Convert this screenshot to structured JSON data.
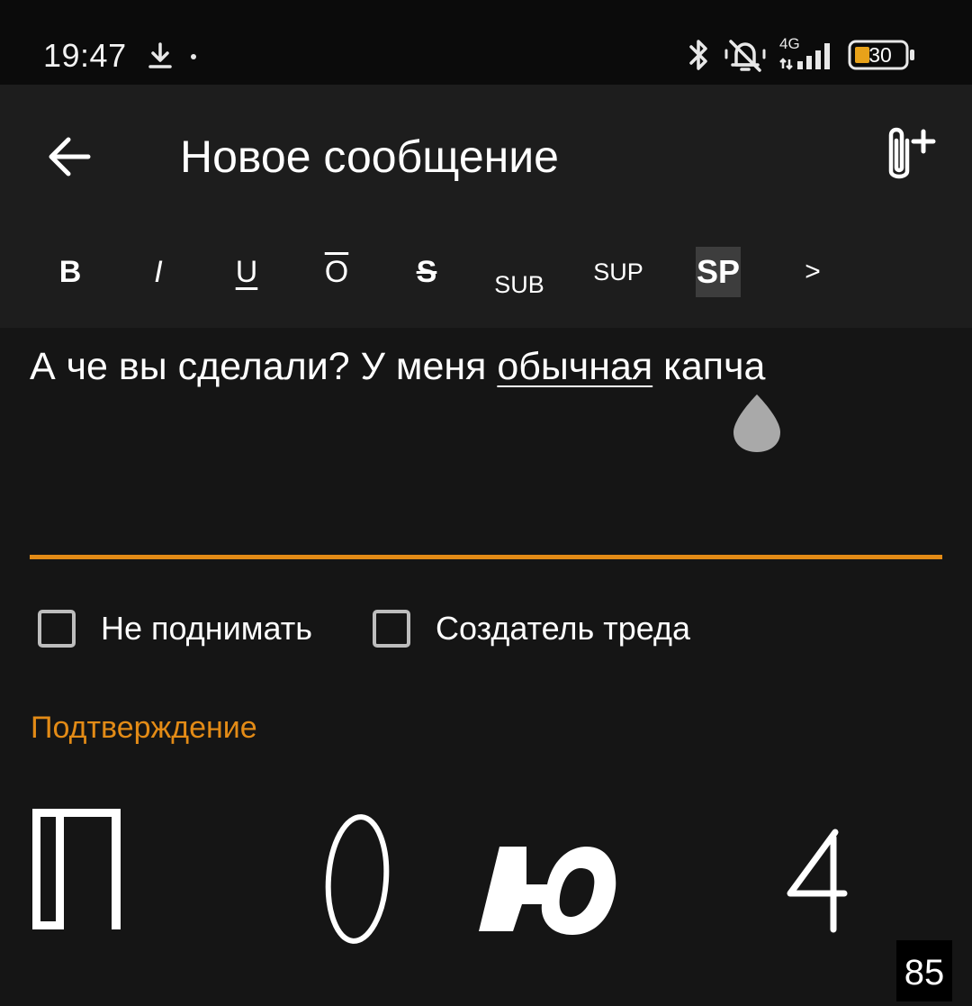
{
  "status_bar": {
    "time": "19:47",
    "network": "4G",
    "battery": "30",
    "icons": [
      "download-icon",
      "bluetooth-icon",
      "muted-bell-icon",
      "signal-icon",
      "battery-icon"
    ]
  },
  "app_bar": {
    "title": "Новое сообщение",
    "back_icon": "arrow-left-icon",
    "attach_icon": "attach-plus-icon"
  },
  "toolbar": {
    "bold": "B",
    "italic": "I",
    "underline": "U",
    "overline": "O",
    "strike": "S",
    "sub": "SUB",
    "sup": "SUP",
    "spoiler": "SP",
    "more": ">"
  },
  "message": {
    "text_before": "А че вы сделали? У меня ",
    "text_underlined": "обычная",
    "text_after": " капча"
  },
  "options": {
    "no_bump_label": "Не поднимать",
    "no_bump_checked": false,
    "op_label": "Создатель треда",
    "op_checked": false
  },
  "captcha": {
    "header": "Подтверждение",
    "counter": "85"
  },
  "colors": {
    "accent": "#e38b16",
    "background": "#151515",
    "surface": "#1d1d1d",
    "status_bar": "#0b0b0b"
  }
}
